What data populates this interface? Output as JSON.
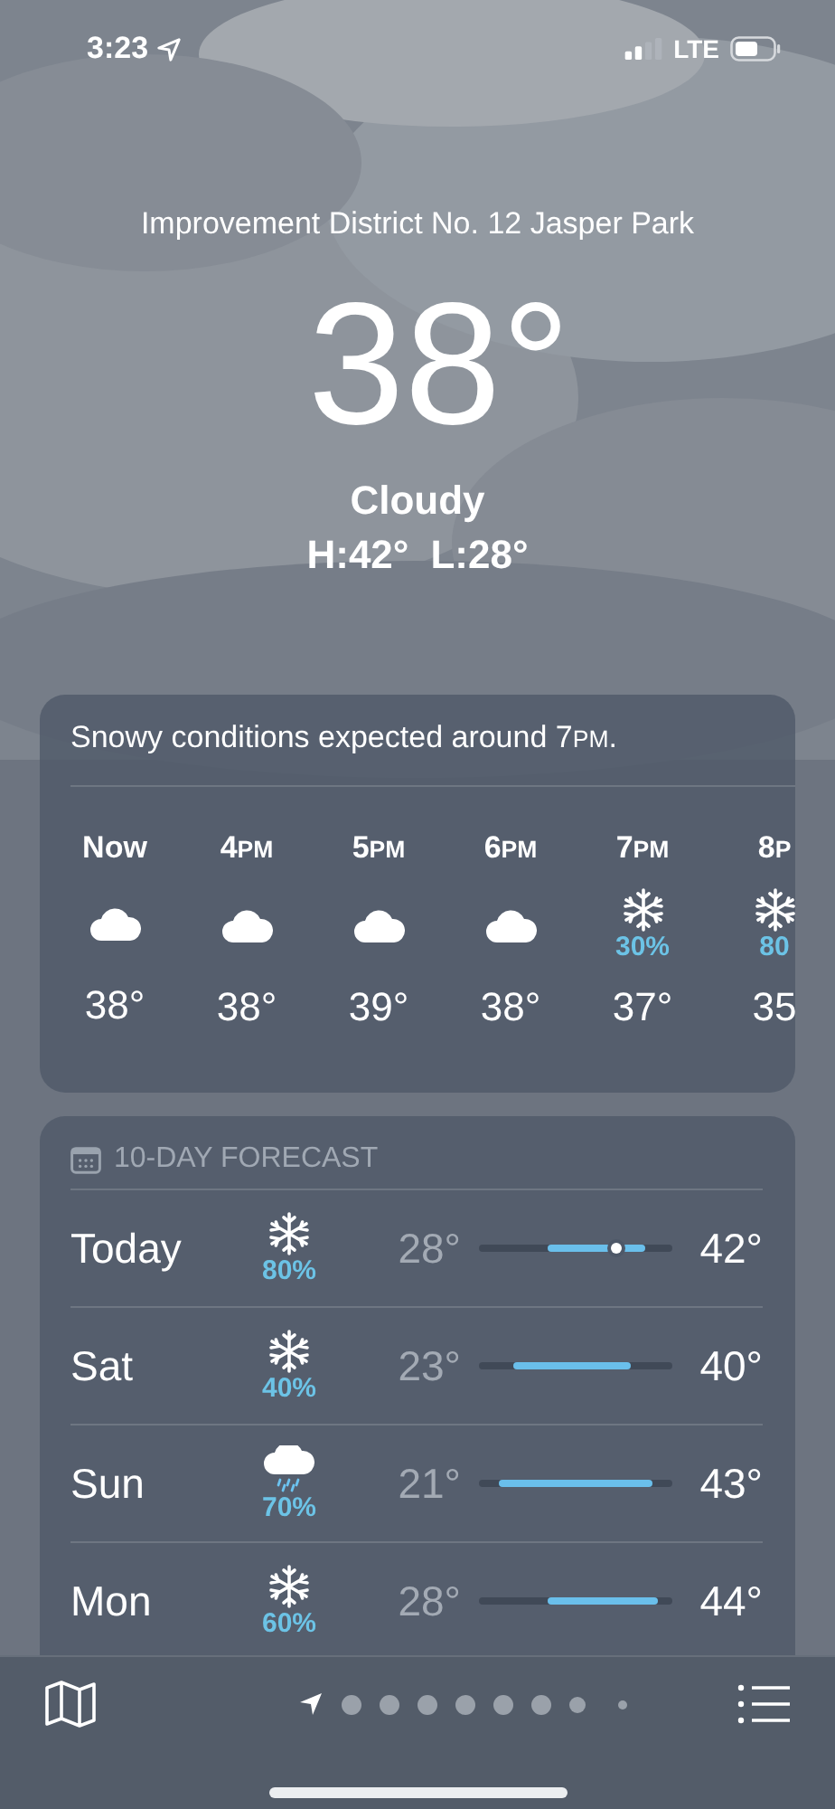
{
  "status_bar": {
    "time": "3:23",
    "location_on": true,
    "network": "LTE"
  },
  "header": {
    "location": "Improvement District No. 12 Jasper Park",
    "temperature": "38°",
    "condition": "Cloudy",
    "high": "H:42°",
    "low": "L:28°"
  },
  "hourly": {
    "alert": {
      "before": "Snowy conditions expected around 7",
      "small": "PM",
      "after": "."
    },
    "hours": [
      {
        "label": "Now",
        "kind": "cloud",
        "temp": "38°"
      },
      {
        "label": "4",
        "suffix": "PM",
        "kind": "cloud",
        "temp": "38°"
      },
      {
        "label": "5",
        "suffix": "PM",
        "kind": "cloud",
        "temp": "39°"
      },
      {
        "label": "6",
        "suffix": "PM",
        "kind": "cloud",
        "temp": "38°"
      },
      {
        "label": "7",
        "suffix": "PM",
        "kind": "snow",
        "precip": "30%",
        "temp": "37°"
      },
      {
        "label": "8",
        "suffix": "P",
        "kind": "snow",
        "precip": "80",
        "temp": "35"
      }
    ]
  },
  "daily": {
    "title": "10-DAY FORECAST",
    "days": [
      {
        "day": "Today",
        "kind": "snow",
        "precip": "80%",
        "low": "28°",
        "high": "42°",
        "current_marker": true
      },
      {
        "day": "Sat",
        "kind": "snow",
        "precip": "40%",
        "low": "23°",
        "high": "40°",
        "current_marker": false
      },
      {
        "day": "Sun",
        "kind": "rain",
        "precip": "70%",
        "low": "21°",
        "high": "43°",
        "current_marker": false
      },
      {
        "day": "Mon",
        "kind": "snow",
        "precip": "60%",
        "low": "28°",
        "high": "44°",
        "current_marker": false
      }
    ]
  },
  "pages": [
    {
      "kind": "location",
      "selected": true
    },
    {
      "kind": "dot",
      "selected": false
    },
    {
      "kind": "dot",
      "selected": false
    },
    {
      "kind": "dot",
      "selected": false
    },
    {
      "kind": "dot",
      "selected": false
    },
    {
      "kind": "dot",
      "selected": false
    },
    {
      "kind": "dot",
      "selected": false
    },
    {
      "kind": "dot",
      "selected": false
    },
    {
      "kind": "dot",
      "selected": false
    }
  ]
}
